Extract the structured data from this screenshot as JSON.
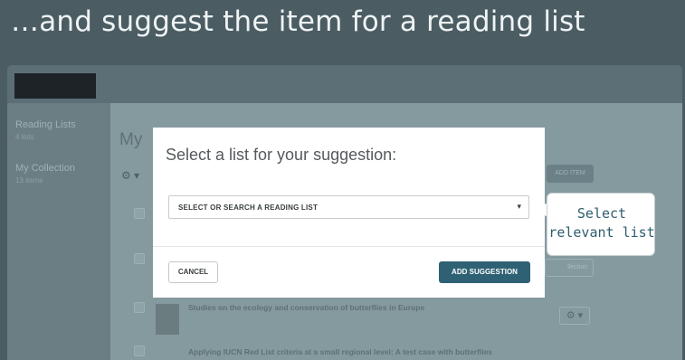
{
  "slide": {
    "title": "…and suggest the item for a reading list"
  },
  "sidebar": {
    "items": [
      {
        "label": "Reading Lists",
        "count": "4 lists"
      },
      {
        "label": "My Collection",
        "count": "13 items"
      }
    ]
  },
  "main": {
    "heading": "My",
    "gear_menu": "⚙ ▾",
    "add_item_label": "ADD ITEM",
    "collection_button": "llection",
    "rows": [
      {
        "title": "Studies on the ecology and conservation of butterflies in Europe"
      },
      {
        "title": "Applying IUCN Red List criteria at a small regional level: A test case with butterflies"
      }
    ]
  },
  "modal": {
    "title": "Select a list for your suggestion:",
    "select_placeholder": "SELECT OR SEARCH A READING LIST",
    "cancel_label": "CANCEL",
    "submit_label": "ADD SUGGESTION"
  },
  "callout": {
    "line1": "Select",
    "line2": "relevant list"
  },
  "colors": {
    "accent": "#2f6174",
    "overlay": "#4b5c63",
    "callout_text": "#2e5e6e"
  }
}
